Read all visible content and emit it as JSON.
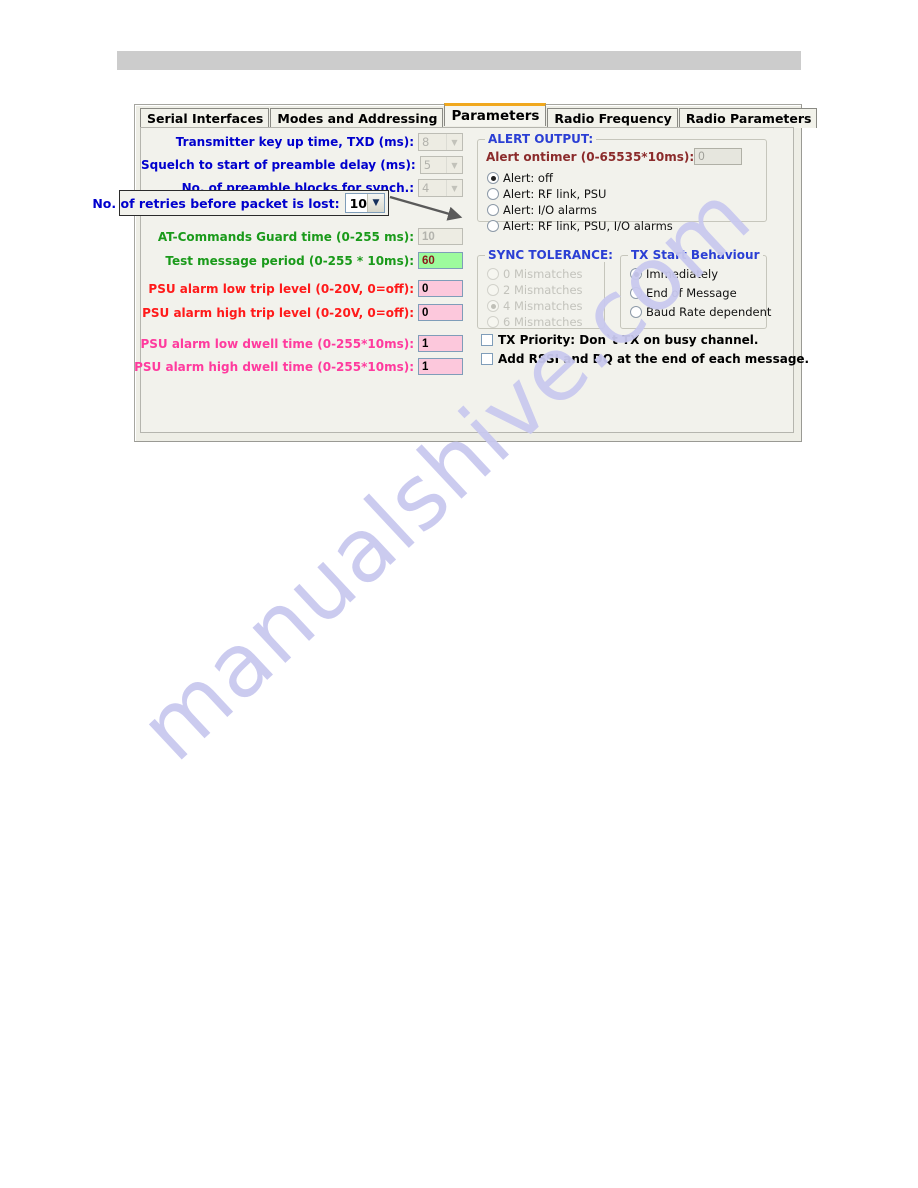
{
  "window": {
    "active_tab": "Parameters"
  },
  "tabs": [
    {
      "label": "Serial Interfaces",
      "active": false
    },
    {
      "label": "Modes and Addressing",
      "active": false
    },
    {
      "label": "Parameters",
      "active": true
    },
    {
      "label": "Radio Frequency",
      "active": false
    },
    {
      "label": "Radio Parameters",
      "active": false
    }
  ],
  "left_fields": [
    {
      "label": "Transmitter key up time, TXD (ms):",
      "value": "8",
      "style": "combo-disabled",
      "color": "blue"
    },
    {
      "label": "Squelch to start of preamble delay (ms):",
      "value": "5",
      "style": "combo-disabled",
      "color": "blue"
    },
    {
      "label": "No. of preamble blocks for synch.:",
      "value": "4",
      "style": "combo-disabled",
      "color": "blue"
    }
  ],
  "retries": {
    "label": "No. of retries before packet is lost:",
    "value": "10",
    "arrow_icon": "arrow-right-icon"
  },
  "value_fields": [
    {
      "label": "AT-Commands Guard time (0-255 ms):",
      "value": "10",
      "color": "green",
      "input": "disabled"
    },
    {
      "label": "Test message period (0-255 * 10ms):",
      "value": "60",
      "color": "green",
      "input": "green"
    },
    {
      "label": "PSU alarm low trip level (0-20V, 0=off):",
      "value": "0",
      "color": "red",
      "input": "pink"
    },
    {
      "label": "PSU alarm high trip level (0-20V, 0=off):",
      "value": "0",
      "color": "red",
      "input": "pink"
    },
    {
      "label": "PSU alarm low dwell time (0-255*10ms):",
      "value": "1",
      "color": "pink",
      "input": "pink"
    },
    {
      "label": "PSU alarm high dwell time (0-255*10ms):",
      "value": "1",
      "color": "pink",
      "input": "pink"
    }
  ],
  "alert_output": {
    "title": "ALERT OUTPUT:",
    "ontimer_label": "Alert ontimer (0-65535*10ms):",
    "ontimer_value": "0",
    "options": [
      {
        "label": "Alert: off",
        "selected": true
      },
      {
        "label": "Alert: RF link, PSU",
        "selected": false
      },
      {
        "label": "Alert: I/O alarms",
        "selected": false
      },
      {
        "label": "Alert: RF link, PSU, I/O alarms",
        "selected": false
      }
    ]
  },
  "sync_tolerance": {
    "title": "SYNC TOLERANCE:",
    "disabled": true,
    "options": [
      {
        "label": "0 Mismatches",
        "selected": false
      },
      {
        "label": "2 Mismatches",
        "selected": false
      },
      {
        "label": "4 Mismatches",
        "selected": true
      },
      {
        "label": "6 Mismatches",
        "selected": false
      }
    ]
  },
  "tx_start_behaviour": {
    "title": "TX Start Behaviour",
    "options": [
      {
        "label": "Immediately",
        "selected": true
      },
      {
        "label": "End of Message",
        "selected": false
      },
      {
        "label": "Baud Rate dependent",
        "selected": false
      }
    ]
  },
  "checkboxes": [
    {
      "label": "TX Priority: Don`t TX on busy channel.",
      "checked": false
    },
    {
      "label": "Add RSSI and DQ at the end of each message.",
      "checked": false
    }
  ],
  "watermark": {
    "text": "manualshive.com"
  },
  "colors": {
    "tab_active_accent": "#f0a81e",
    "label_blue": "#0000cd",
    "label_green": "#1a9a1a",
    "label_red": "#ff1a1a",
    "label_pink": "#ff3b9e",
    "group_title_blue": "#2b3fd4",
    "input_green": "#9dfb9d",
    "input_pink": "#fcc8dc",
    "top_band": "#cccccc",
    "dialog_bg": "#f2f2ec"
  }
}
